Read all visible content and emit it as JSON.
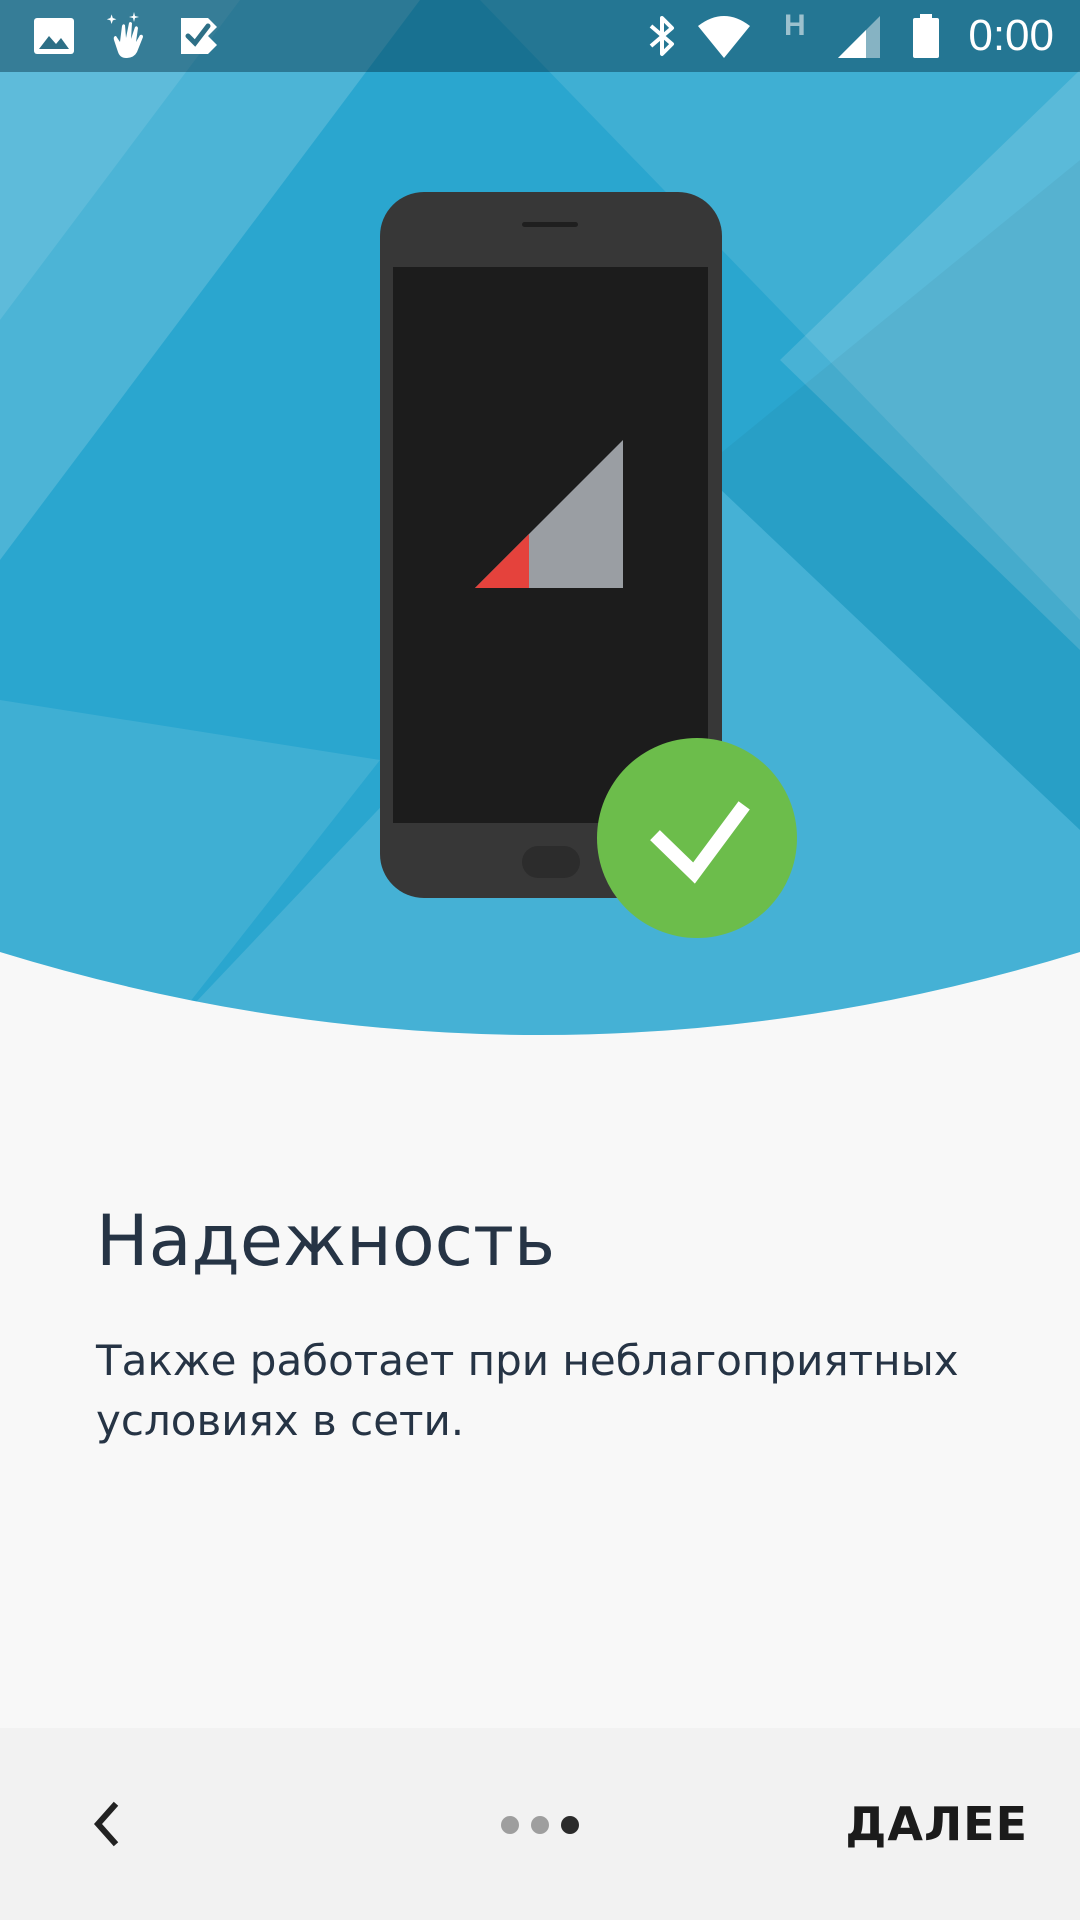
{
  "status_bar": {
    "time": "0:00",
    "network_type": "H",
    "left_icons": [
      "gallery-notification-icon",
      "gesture-sparkle-icon",
      "task-check-icon"
    ],
    "right_icons": [
      "bluetooth-icon",
      "wifi-icon",
      "network-type-icon",
      "cell-signal-icon",
      "battery-icon"
    ]
  },
  "hero": {
    "background_color": "#2aa6cf",
    "phone_color": "#373737",
    "screen_color": "#1c1c1c",
    "signal_level_color": "#e5423c",
    "signal_empty_color": "#9a9ea3",
    "check_badge_color": "#6cbd4b",
    "icons": [
      "phone-illustration",
      "signal-strength-icon",
      "check-badge-icon"
    ]
  },
  "content": {
    "title": "Надежность",
    "description": "Также работает при неблагоприятных условиях в сети."
  },
  "bottom_bar": {
    "back_icon": "chevron-left-icon",
    "next_label": "ДАЛЕЕ",
    "page_indicator": {
      "total": 3,
      "current": 3,
      "active_color": "#2b2b2b",
      "inactive_color": "#9e9e9e"
    }
  }
}
